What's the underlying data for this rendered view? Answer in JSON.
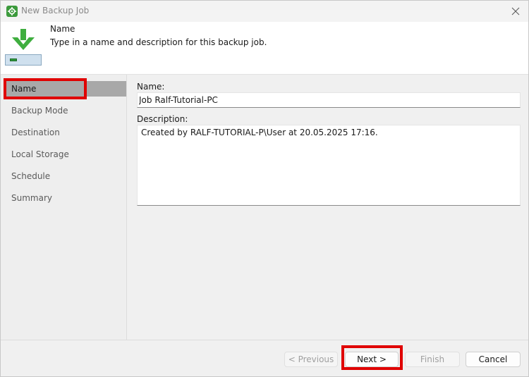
{
  "window": {
    "title": "New Backup Job"
  },
  "header": {
    "title": "Name",
    "description": "Type in a name and description for this backup job."
  },
  "sidebar": {
    "items": [
      {
        "label": "Name",
        "active": true
      },
      {
        "label": "Backup Mode",
        "active": false
      },
      {
        "label": "Destination",
        "active": false
      },
      {
        "label": "Local Storage",
        "active": false
      },
      {
        "label": "Schedule",
        "active": false
      },
      {
        "label": "Summary",
        "active": false
      }
    ]
  },
  "form": {
    "name_label": "Name:",
    "name_value": "Job Ralf-Tutorial-PC",
    "description_label": "Description:",
    "description_value": "Created by RALF-TUTORIAL-P\\User at 20.05.2025 17:16."
  },
  "footer": {
    "previous_label": "< Previous",
    "next_label": "Next >",
    "finish_label": "Finish",
    "cancel_label": "Cancel"
  },
  "colors": {
    "highlight": "#e00000",
    "active_item": "#a8a8a8",
    "accent_green": "#3c9a3c"
  },
  "icons": {
    "app": "veeam-gear-icon",
    "close": "close-icon",
    "wizard": "download-arrow-icon",
    "drive": "backup-drive-icon"
  }
}
